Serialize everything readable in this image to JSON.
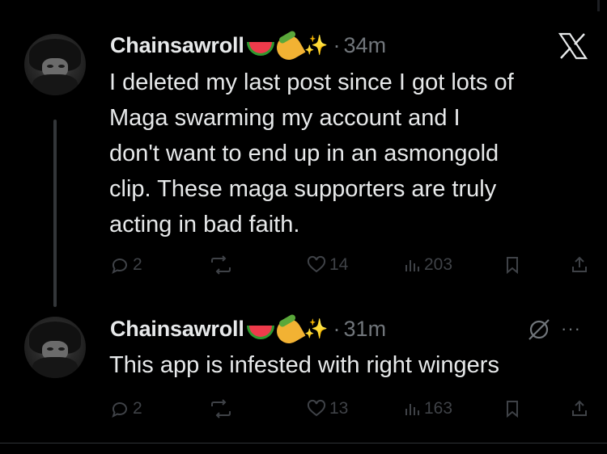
{
  "tweets": [
    {
      "author": "Chainsawroll",
      "emojis": [
        "watermelon",
        "taco",
        "sparkles"
      ],
      "time": "34m",
      "text": "I deleted my last post since I got lots of\nMaga swarming my account and I\ndon't want to end up in an asmongold\nclip. These maga supporters are truly\nacting in bad faith.",
      "replies": "2",
      "likes": "14",
      "views": "203"
    },
    {
      "author": "Chainsawroll",
      "emojis": [
        "watermelon",
        "taco",
        "sparkles"
      ],
      "time": "31m",
      "text": "This app is infested with right wingers",
      "replies": "2",
      "likes": "13",
      "views": "163"
    }
  ],
  "separator": "·",
  "more_label": "···",
  "colors": {
    "background": "#000000",
    "text": "#e7e9ea",
    "muted": "#71767b",
    "icon_dim": "#3f4247"
  }
}
